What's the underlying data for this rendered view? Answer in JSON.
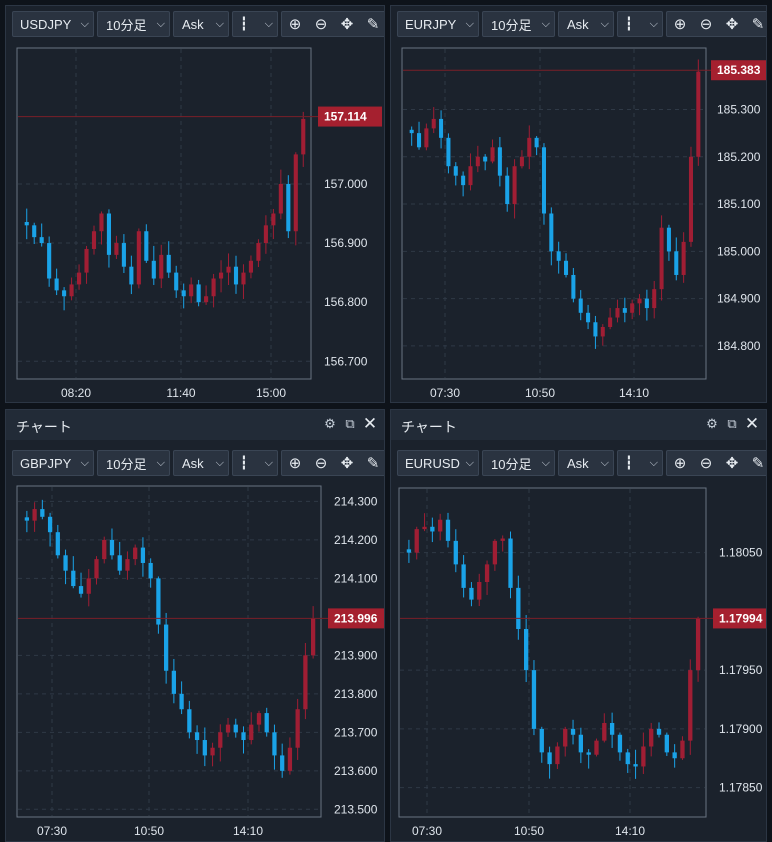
{
  "colors": {
    "up": "#a01e34",
    "down": "#1aa3e8",
    "current_line": "#7a1f28",
    "tag": "#a5202f"
  },
  "panels": [
    {
      "title": "",
      "toolbar": {
        "symbol": "USDJPY",
        "timeframe": "10分足",
        "price": "Ask"
      },
      "y_labels": [
        "157.000",
        "156.900",
        "156.800",
        "156.700"
      ],
      "x_labels": [
        "08:20",
        "11:40",
        "15:00"
      ],
      "current_price": "157.114"
    },
    {
      "title": "",
      "toolbar": {
        "symbol": "EURJPY",
        "timeframe": "10分足",
        "price": "Ask"
      },
      "y_labels": [
        "185.300",
        "185.200",
        "185.100",
        "185.000",
        "184.900",
        "184.800"
      ],
      "x_labels": [
        "07:30",
        "10:50",
        "14:10"
      ],
      "current_price": "185.383"
    },
    {
      "title": "チャート",
      "toolbar": {
        "symbol": "GBPJPY",
        "timeframe": "10分足",
        "price": "Ask"
      },
      "y_labels": [
        "214.300",
        "214.200",
        "214.100",
        "213.900",
        "213.800",
        "213.700",
        "213.600",
        "213.500"
      ],
      "x_labels": [
        "07:30",
        "10:50",
        "14:10"
      ],
      "current_price": "213.996"
    },
    {
      "title": "チャート",
      "toolbar": {
        "symbol": "EURUSD",
        "timeframe": "10分足",
        "price": "Ask"
      },
      "y_labels": [
        "1.18050",
        "1.17950",
        "1.17900",
        "1.17850"
      ],
      "x_labels": [
        "07:30",
        "10:50",
        "14:10"
      ],
      "current_price": "1.17994"
    }
  ],
  "chart_data": [
    {
      "type": "candlestick",
      "symbol": "USDJPY",
      "ylim": [
        156.67,
        157.23
      ],
      "x_ticks": [
        "08:20",
        "11:40",
        "15:00"
      ],
      "current": 157.114,
      "close_path": [
        156.93,
        156.91,
        156.9,
        156.84,
        156.82,
        156.81,
        156.83,
        156.85,
        156.89,
        156.92,
        156.95,
        156.88,
        156.9,
        156.86,
        156.83,
        156.92,
        156.87,
        156.84,
        156.88,
        156.85,
        156.82,
        156.81,
        156.83,
        156.8,
        156.81,
        156.84,
        156.85,
        156.86,
        156.83,
        156.85,
        156.87,
        156.9,
        156.93,
        156.95,
        157.0,
        156.92,
        157.05,
        157.11
      ]
    },
    {
      "type": "candlestick",
      "symbol": "EURJPY",
      "ylim": [
        184.73,
        185.43
      ],
      "x_ticks": [
        "07:30",
        "10:50",
        "14:10"
      ],
      "current": 185.383,
      "close_path": [
        185.25,
        185.22,
        185.26,
        185.28,
        185.24,
        185.18,
        185.16,
        185.14,
        185.18,
        185.2,
        185.19,
        185.22,
        185.16,
        185.1,
        185.18,
        185.2,
        185.24,
        185.22,
        185.08,
        185.0,
        184.98,
        184.95,
        184.9,
        184.87,
        184.85,
        184.82,
        184.84,
        184.86,
        184.88,
        184.87,
        184.89,
        184.9,
        184.88,
        184.92,
        185.05,
        185.0,
        184.95,
        185.02,
        185.2,
        185.38
      ]
    },
    {
      "type": "candlestick",
      "symbol": "GBPJPY",
      "ylim": [
        213.48,
        214.34
      ],
      "x_ticks": [
        "07:30",
        "10:50",
        "14:10"
      ],
      "current": 213.996,
      "close_path": [
        214.25,
        214.28,
        214.26,
        214.22,
        214.16,
        214.12,
        214.08,
        214.06,
        214.1,
        214.15,
        214.2,
        214.16,
        214.12,
        214.15,
        214.18,
        214.14,
        214.1,
        213.98,
        213.86,
        213.8,
        213.76,
        213.7,
        213.68,
        213.64,
        213.66,
        213.7,
        213.72,
        213.7,
        213.68,
        213.72,
        213.75,
        213.7,
        213.64,
        213.6,
        213.66,
        213.76,
        213.9,
        213.996
      ]
    },
    {
      "type": "candlestick",
      "symbol": "EURUSD",
      "ylim": [
        1.17825,
        1.18105
      ],
      "x_ticks": [
        "07:30",
        "10:50",
        "14:10"
      ],
      "current": 1.17994,
      "close_path": [
        1.1805,
        1.1807,
        1.18072,
        1.18068,
        1.18078,
        1.1806,
        1.1804,
        1.1802,
        1.1801,
        1.18025,
        1.1804,
        1.1806,
        1.18062,
        1.1802,
        1.17985,
        1.1795,
        1.179,
        1.1788,
        1.1787,
        1.17885,
        1.179,
        1.17895,
        1.1788,
        1.17878,
        1.1789,
        1.17905,
        1.17895,
        1.1788,
        1.1787,
        1.17868,
        1.17885,
        1.179,
        1.17895,
        1.1788,
        1.17875,
        1.1789,
        1.1795,
        1.17994
      ]
    }
  ]
}
